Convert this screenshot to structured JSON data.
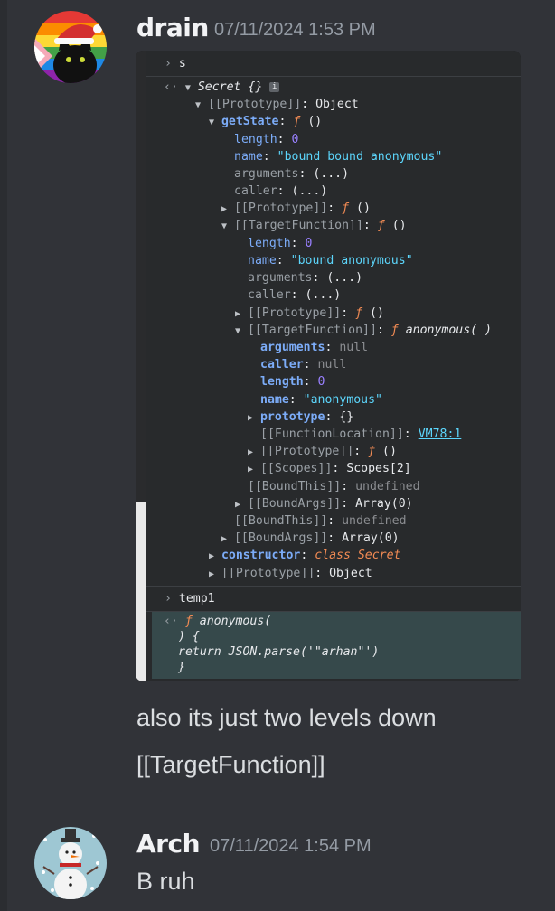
{
  "messages": [
    {
      "username": "drain",
      "timestamp": "07/11/2024 1:53 PM",
      "text_lines": [
        "also its just two levels down",
        "[[TargetFunction]]"
      ]
    },
    {
      "username": "Arch",
      "timestamp": "07/11/2024 1:54 PM",
      "text": "B ruh"
    }
  ],
  "console": {
    "input1": "s",
    "lines": [
      {
        "key": "Secret {}"
      },
      {
        "key": "[[Prototype]]",
        "val": "Object"
      },
      {
        "key": "getState",
        "val": "ƒ ()"
      },
      {
        "key": "length",
        "val": "0"
      },
      {
        "key": "name",
        "val": "\"bound bound anonymous\""
      },
      {
        "key": "arguments",
        "val": "(...)"
      },
      {
        "key": "caller",
        "val": "(...)"
      },
      {
        "key": "[[Prototype]]",
        "val": "ƒ ()"
      },
      {
        "key": "[[TargetFunction]]",
        "val": "ƒ ()"
      },
      {
        "key": "length",
        "val": "0"
      },
      {
        "key": "name",
        "val": "\"bound anonymous\""
      },
      {
        "key": "arguments",
        "val": "(...)"
      },
      {
        "key": "caller",
        "val": "(...)"
      },
      {
        "key": "[[Prototype]]",
        "val": "ƒ ()"
      },
      {
        "key": "[[TargetFunction]]",
        "val": "ƒ anonymous( )"
      },
      {
        "key": "arguments",
        "val": "null"
      },
      {
        "key": "caller",
        "val": "null"
      },
      {
        "key": "length",
        "val": "0"
      },
      {
        "key": "name",
        "val": "\"anonymous\""
      },
      {
        "key": "prototype",
        "val": "{}"
      },
      {
        "key": "[[FunctionLocation]]",
        "val": "VM78:1"
      },
      {
        "key": "[[Prototype]]",
        "val": "ƒ ()"
      },
      {
        "key": "[[Scopes]]",
        "val": "Scopes[2]"
      },
      {
        "key": "[[BoundThis]]",
        "val": "undefined"
      },
      {
        "key": "[[BoundArgs]]",
        "val": "Array(0)"
      },
      {
        "key": "[[BoundThis]]",
        "val": "undefined"
      },
      {
        "key": "[[BoundArgs]]",
        "val": "Array(0)"
      },
      {
        "key": "constructor",
        "val": "class Secret"
      },
      {
        "key": "[[Prototype]]",
        "val": "Object"
      }
    ],
    "input2": "temp1",
    "result_lines": [
      "ƒ anonymous(",
      ") {",
      "return JSON.parse('\"arhan\"')",
      "}"
    ]
  },
  "colors": {
    "background": "#313338",
    "username": "#f2f3f5",
    "timestamp": "#949ba4"
  }
}
